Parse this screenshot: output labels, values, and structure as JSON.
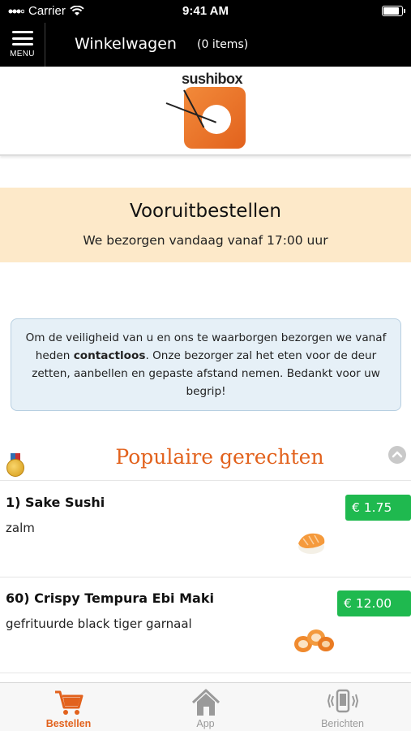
{
  "status_bar": {
    "carrier": "Carrier",
    "time": "9:41 AM"
  },
  "header": {
    "menu_label": "MENU",
    "title": "Winkelwagen",
    "item_count": "(0 items)"
  },
  "logo": {
    "text": "sushibox"
  },
  "banner": {
    "title": "Vooruitbestellen",
    "subtitle": "We bezorgen vandaag vanaf 17:00 uur"
  },
  "notice": {
    "text_before": "Om de veiligheid van u en ons te waarborgen bezorgen we vanaf heden ",
    "bold": "contactloos",
    "text_after": ". Onze bezorger zal het eten voor de deur zetten, aanbellen en gepaste afstand nemen. Bedankt voor uw begrip!"
  },
  "section": {
    "title": "Populaire gerechten",
    "medal_icon": "medal-icon",
    "collapse_icon": "chevron-up-icon"
  },
  "dishes": [
    {
      "name": "1)  Sake Sushi",
      "description": "zalm",
      "price": "€ 1.75 +"
    },
    {
      "name": "60)  Crispy Tempura Ebi Maki",
      "description": "gefrituurde black tiger garnaal",
      "price": "€ 12.00 +"
    }
  ],
  "tabbar": {
    "tabs": [
      {
        "label": "Bestellen",
        "icon": "cart-icon",
        "active": true
      },
      {
        "label": "App",
        "icon": "home-icon",
        "active": false
      },
      {
        "label": "Berichten",
        "icon": "phone-vibrate-icon",
        "active": false
      }
    ]
  },
  "colors": {
    "accent": "#e2621d",
    "price_green": "#1fb94f",
    "banner_bg": "#fde9c9",
    "notice_bg": "#e6f0f7"
  }
}
